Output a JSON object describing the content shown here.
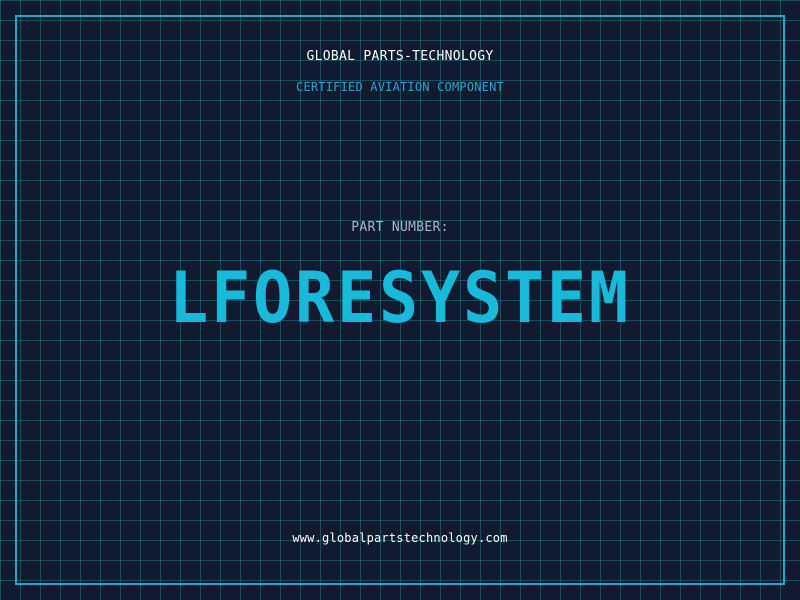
{
  "header": {
    "company": "GLOBAL PARTS-TECHNOLOGY",
    "subtitle": "CERTIFIED AVIATION COMPONENT"
  },
  "part": {
    "label": "PART NUMBER:",
    "value": "LFORESYSTEM"
  },
  "footer": {
    "website": "www.globalpartstechnology.com"
  },
  "colors": {
    "background": "#111a2e",
    "grid": "#1e788c",
    "frame": "#1ea8cf",
    "accent": "#19b9da",
    "subtitle": "#2aa6d2",
    "label": "#a9b6c8",
    "text": "#ffffff"
  }
}
